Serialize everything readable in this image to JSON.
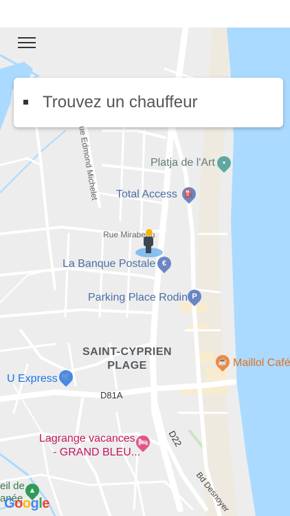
{
  "search": {
    "placeholder": "Trouvez un chauffeur"
  },
  "map": {
    "places": {
      "platja": "Platja de l'Art",
      "total": "Total Access",
      "mirabeau": "Rue Mirabeau",
      "banque": "La Banque Postale",
      "parking": "Parking Place Rodin",
      "district_line1": "SAINT-CYPRIEN",
      "district_line2": "PLAGE",
      "maillol": "Maillol Café",
      "uexpress": "U Express",
      "lagrange_line1": "Lagrange vacances",
      "lagrange_line2": "- GRAND BLEU...",
      "edmond": "ue Edmond Michelet",
      "d81a": "D81A",
      "d22": "D22",
      "desnoyer": "Bd Desnoyer",
      "soleil_line1": "eil de",
      "soleil_line2": "anée"
    },
    "attribution": [
      "G",
      "o",
      "o",
      "g",
      "l",
      "e"
    ]
  },
  "colors": {
    "sea": "#aadaff",
    "land": "#ededed",
    "road": "#ffffff",
    "beach": "#f8ecd0"
  }
}
